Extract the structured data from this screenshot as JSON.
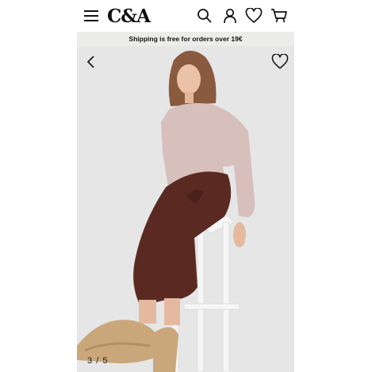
{
  "header": {
    "logo_text": "C&A",
    "icons": [
      "menu-icon",
      "search-icon",
      "account-icon",
      "heart-icon",
      "cart-icon"
    ]
  },
  "banner": {
    "text": "Shipping is free for orders over 19€"
  },
  "gallery": {
    "current": "3",
    "separator": "/",
    "total": "5",
    "icons": [
      "chevron-left-icon",
      "heart-outline-icon"
    ]
  },
  "colors": {
    "banner_bg": "#ecedea",
    "photo_bg": "#e6e6e6",
    "blouse": "#d7bfbb",
    "trousers": "#5a2a22",
    "stool": "#f6f6f6",
    "sandals": "#c9a77a"
  }
}
